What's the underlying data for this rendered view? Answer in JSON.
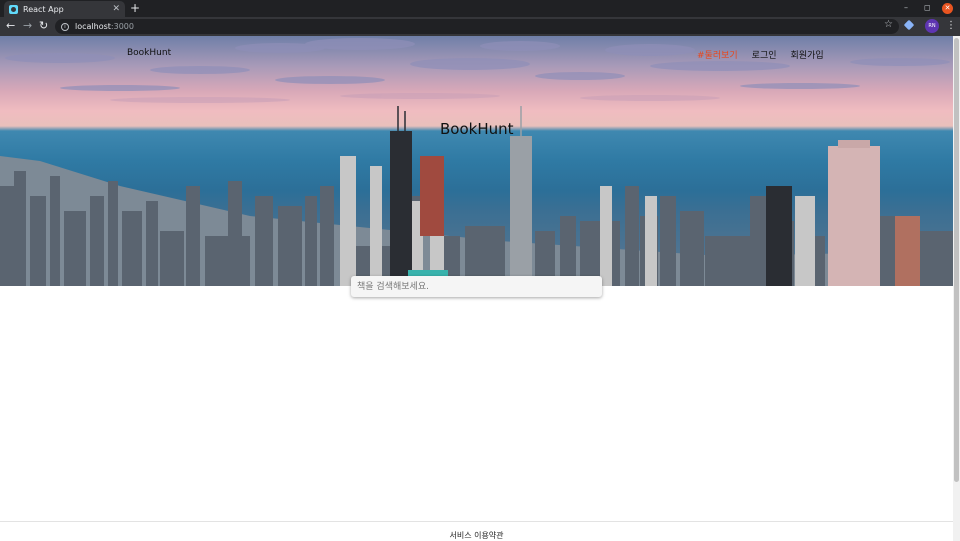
{
  "browser": {
    "tab": {
      "title": "React App",
      "close": "✕"
    },
    "new_tab": "+",
    "url": {
      "host": "localhost",
      "port": ":3000"
    },
    "window_controls": {
      "minimize": "–",
      "maximize": "◻",
      "close": "✕"
    },
    "profile_initials": "RN",
    "icons": [
      "back-icon",
      "forward-icon",
      "reload-icon",
      "info-icon",
      "star-icon",
      "extension-icon",
      "profile-icon",
      "menu-icon"
    ]
  },
  "header": {
    "brand": "BookHunt",
    "nav": [
      {
        "label": "#둘러보기",
        "active": true
      },
      {
        "label": "로그인",
        "active": false
      },
      {
        "label": "회원가입",
        "active": false
      }
    ]
  },
  "hero": {
    "title": "BookHunt"
  },
  "search": {
    "placeholder": "책을 검색해보세요."
  },
  "footer": {
    "link": "서비스 이용약관"
  },
  "colors": {
    "active_nav": "#e8471b",
    "chrome_dark": "#202124",
    "chrome_toolbar": "#35363a"
  }
}
